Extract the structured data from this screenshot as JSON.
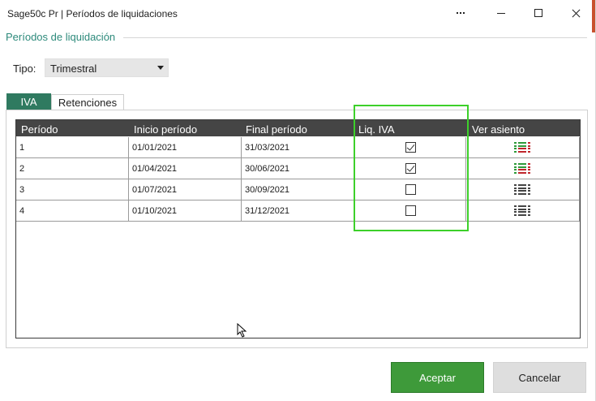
{
  "window": {
    "title": "Sage50c Pr | Períodos de liquidaciones",
    "accent_color": "#2d8a7b"
  },
  "section": {
    "title": "Períodos de liquidación"
  },
  "tipo": {
    "label": "Tipo:",
    "selected": "Trimestral"
  },
  "tabs": [
    {
      "label": "IVA",
      "active": true
    },
    {
      "label": "Retenciones",
      "active": false
    }
  ],
  "grid": {
    "columns": [
      "Período",
      "Inicio período",
      "Final período",
      "Liq. IVA",
      "Ver asiento"
    ],
    "rows": [
      {
        "periodo": "1",
        "inicio": "01/01/2021",
        "final": "31/03/2021",
        "liq_iva": true,
        "asiento_icon": "ledger-colored-icon"
      },
      {
        "periodo": "2",
        "inicio": "01/04/2021",
        "final": "30/06/2021",
        "liq_iva": true,
        "asiento_icon": "ledger-colored-icon"
      },
      {
        "periodo": "3",
        "inicio": "01/07/2021",
        "final": "30/09/2021",
        "liq_iva": false,
        "asiento_icon": "ledger-gray-icon"
      },
      {
        "periodo": "4",
        "inicio": "01/10/2021",
        "final": "31/12/2021",
        "liq_iva": false,
        "asiento_icon": "ledger-gray-icon"
      }
    ]
  },
  "buttons": {
    "accept": "Aceptar",
    "cancel": "Cancelar"
  },
  "colors": {
    "highlight": "#3dd02a",
    "tab_active": "#2f7a60",
    "accept_button": "#3e9a3a",
    "header_bg": "#454545"
  }
}
